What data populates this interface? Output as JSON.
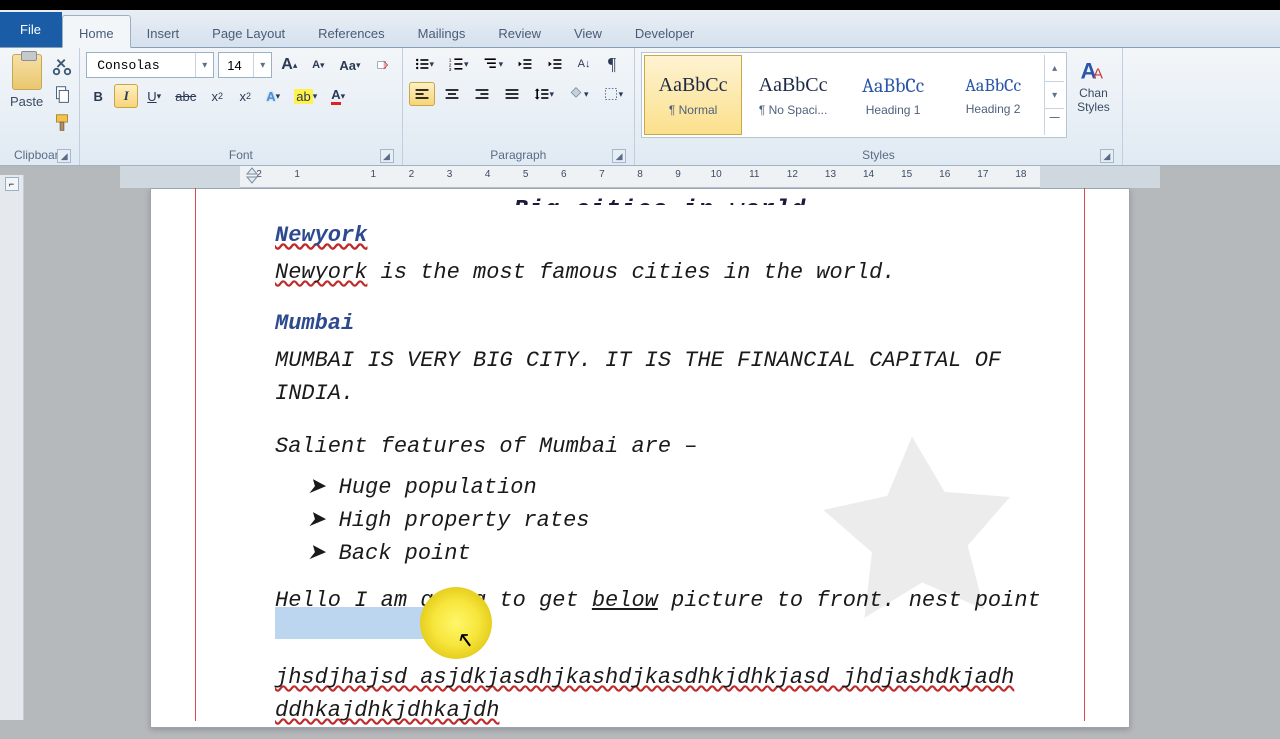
{
  "tabs": {
    "file": "File",
    "home": "Home",
    "insert": "Insert",
    "page_layout": "Page Layout",
    "references": "References",
    "mailings": "Mailings",
    "review": "Review",
    "view": "View",
    "developer": "Developer"
  },
  "clipboard": {
    "paste": "Paste",
    "label": "Clipboard"
  },
  "font": {
    "name": "Consolas",
    "size": "14",
    "label": "Font"
  },
  "paragraph": {
    "label": "Paragraph"
  },
  "styles": {
    "preview": "AaBbCc",
    "normal": "¶ Normal",
    "nospacing": "¶ No Spaci...",
    "heading1": "Heading 1",
    "heading2": "Heading 2",
    "label": "Styles",
    "change": "Chan\nStyles"
  },
  "doc": {
    "title_cut": "Big cities in world",
    "ny_head": "Newyork",
    "ny_para": "is the most famous cities in the world.",
    "mumbai_head": "Mumbai",
    "mumbai_para": "MUMBAI IS VERY BIG CITY. IT IS THE FINANCIAL CAPITAL OF INDIA.",
    "salient": "Salient features of Mumbai are –",
    "li1": "Huge population",
    "li2": "High property rates",
    "li3": "Back point",
    "hello1": "Hello I am going to get ",
    "below": "below",
    "hello2": " picture to front. nest point",
    "gibberish": "jhsdjhajsd asjdkjasdhjkashdjkasdhkjdhkjasd jhdjashdkjadh ddhkajdhkjdhkajdh"
  },
  "ruler": [
    "2",
    "1",
    "",
    "1",
    "2",
    "3",
    "4",
    "5",
    "6",
    "7",
    "8",
    "9",
    "10",
    "11",
    "12",
    "13",
    "14",
    "15",
    "16",
    "17",
    "18"
  ]
}
